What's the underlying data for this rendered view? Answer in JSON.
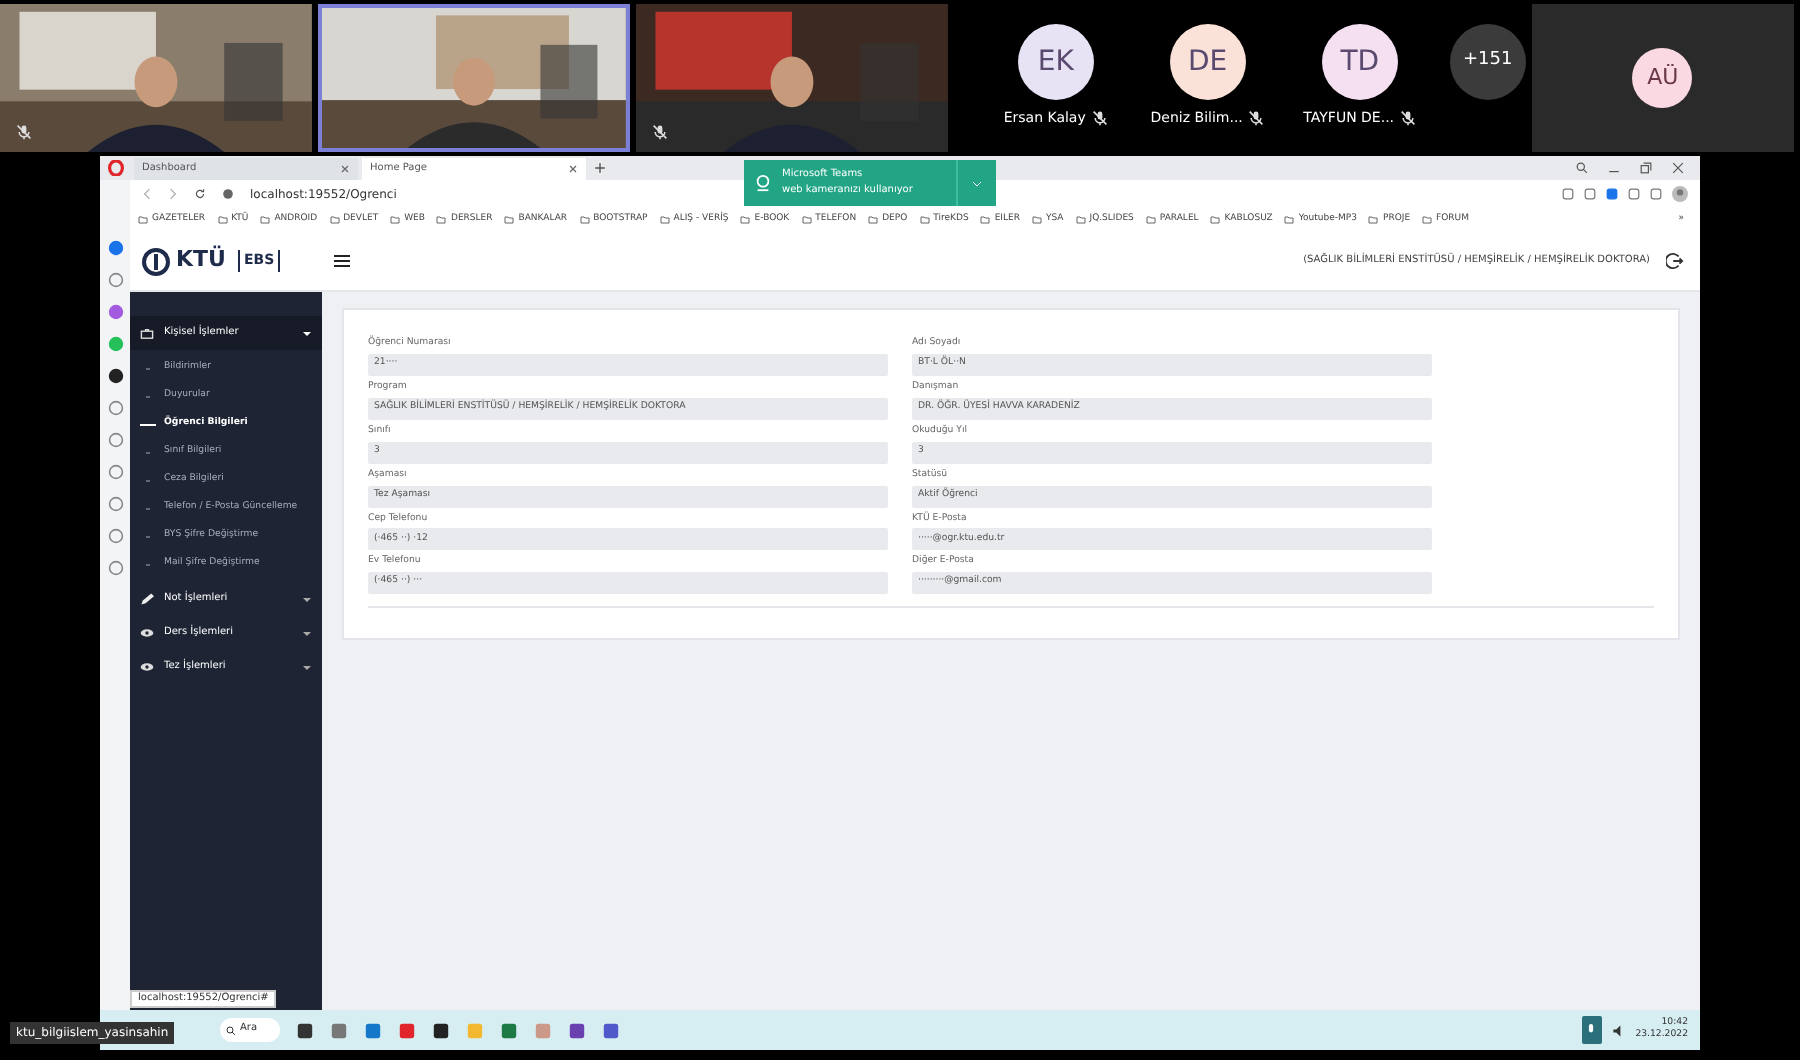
{
  "videos": [
    {
      "kind": "picture",
      "muted": true,
      "speaking": false
    },
    {
      "kind": "picture",
      "muted": false,
      "speaking": true
    },
    {
      "kind": "picture",
      "muted": true,
      "speaking": false
    }
  ],
  "participants": [
    {
      "initials": "EK",
      "name": "Ersan Kalay",
      "color": "#e7e3f4",
      "muted": true
    },
    {
      "initials": "DE",
      "name": "Deniz Bilim...",
      "color": "#fbe2d8",
      "muted": true
    },
    {
      "initials": "TD",
      "name": "TAYFUN DE...",
      "color": "#f4e0f1",
      "muted": true
    }
  ],
  "overflow_count": "+151",
  "self_tile": {
    "initials": "AÜ",
    "color": "#fbd9e2"
  },
  "browser": {
    "tabs": [
      {
        "title": "Dashboard",
        "selected": false
      },
      {
        "title": "Home Page",
        "selected": true
      }
    ],
    "address": "localhost:19552/Ogrenci",
    "bookmarks": [
      "GAZETELER",
      "KTÜ",
      "ANDROID",
      "DEVLET",
      "WEB",
      "DERSLER",
      "BANKALAR",
      "BOOTSTRAP",
      "ALIŞ - VERİŞ",
      "E-BOOK",
      "TELEFON",
      "DEPO",
      "TireKDS",
      "EILER",
      "YSA",
      "JQ.SLIDES",
      "PARALEL",
      "KABLOSUZ",
      "Youtube-MP3",
      "PROJE",
      "FORUM"
    ],
    "more": "»",
    "status_url": "localhost:19552/Ogrenci#"
  },
  "notification": {
    "title": "Microsoft Teams",
    "text": "web kameranızı kullanıyor"
  },
  "app": {
    "logo": "KTÜ",
    "module": "EBS",
    "user_info": "(SAĞLIK BİLİMLERİ ENSTİTÜSÜ / HEMŞİRELİK / HEMŞİRELİK DOKTORA)",
    "menu": [
      {
        "label": "Kişisel İşlemler",
        "expanded": true,
        "children": [
          {
            "label": "Bildirimler",
            "selected": false
          },
          {
            "label": "Duyurular",
            "selected": false
          },
          {
            "label": "Öğrenci Bilgileri",
            "selected": true
          },
          {
            "label": "Sınıf Bilgileri",
            "selected": false
          },
          {
            "label": "Ceza Bilgileri",
            "selected": false
          },
          {
            "label": "Telefon / E-Posta Güncelleme",
            "selected": false
          },
          {
            "label": "BYS Şifre Değiştirme",
            "selected": false
          },
          {
            "label": "Mail Şifre Değiştirme",
            "selected": false
          }
        ]
      },
      {
        "label": "Not İşlemleri",
        "expanded": false
      },
      {
        "label": "Ders İşlemleri",
        "expanded": false
      },
      {
        "label": "Tez İşlemleri",
        "expanded": false
      }
    ],
    "fields": [
      {
        "label": "Öğrenci Numarası",
        "value": "21····"
      },
      {
        "label": "Adı Soyadı",
        "value": "BT·L ÖL··N"
      },
      {
        "label": "Program",
        "value": "SAĞLIK BİLİMLERİ ENSTİTÜSÜ / HEMŞİRELİK / HEMŞİRELİK DOKTORA"
      },
      {
        "label": "Danışman",
        "value": "DR. ÖĞR. ÜYESİ HAVVA KARADENİZ"
      },
      {
        "label": "Sınıfı",
        "value": "3"
      },
      {
        "label": "Okuduğu Yıl",
        "value": "3"
      },
      {
        "label": "Aşaması",
        "value": "Tez Aşaması"
      },
      {
        "label": "Statüsü",
        "value": "Aktif Öğrenci"
      },
      {
        "label": "Cep Telefonu",
        "value": "(·465 ··) ·12"
      },
      {
        "label": "KTÜ E-Posta",
        "value": "·····@ogr.ktu.edu.tr"
      },
      {
        "label": "Ev Telefonu",
        "value": "(·465 ··) ···"
      },
      {
        "label": "Diğer E-Posta",
        "value": "·········@gmail.com"
      }
    ]
  },
  "taskbar": {
    "search": "Ara",
    "time": "10:42",
    "date": "23.12.2022"
  },
  "presenter_label": "ktu_bilgiislem_yasinsahin"
}
